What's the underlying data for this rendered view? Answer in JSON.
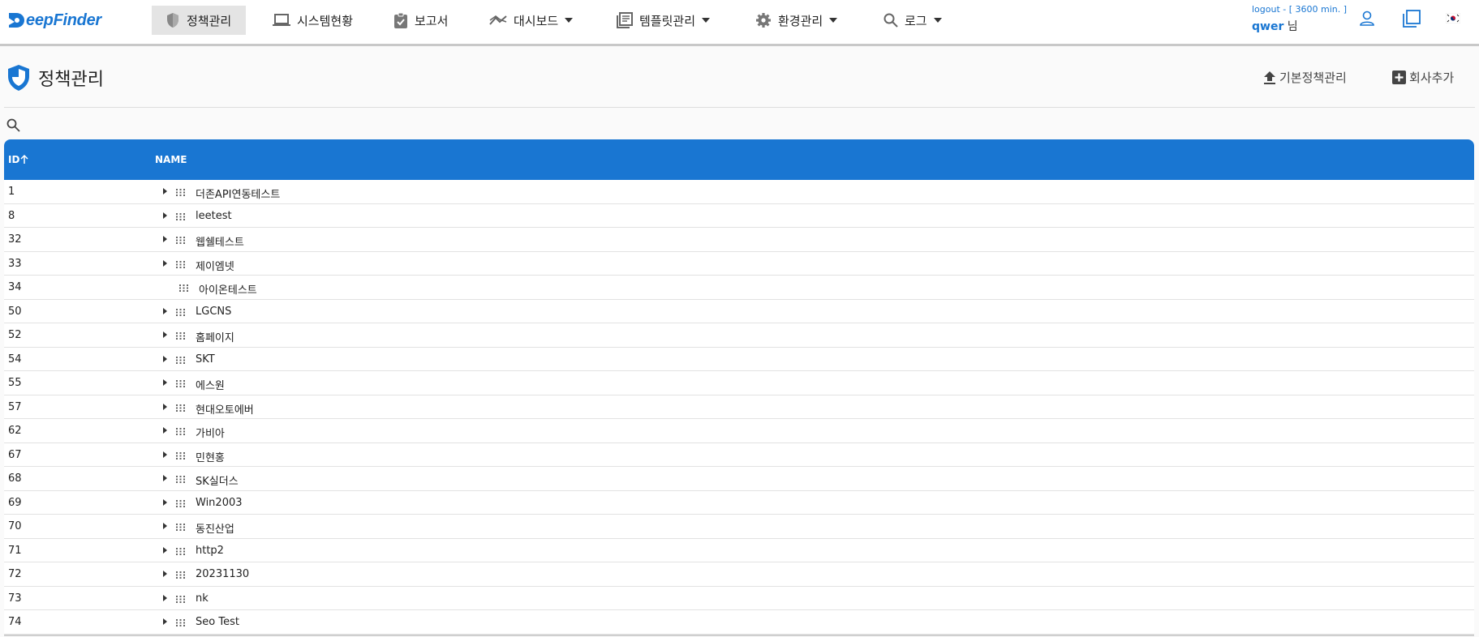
{
  "brand": "DeepFinder",
  "nav": [
    {
      "label": "정책관리",
      "icon": "shield-icon",
      "active": true
    },
    {
      "label": "시스템현황",
      "icon": "laptop-icon"
    },
    {
      "label": "보고서",
      "icon": "clipboard-check-icon"
    },
    {
      "label": "대시보드",
      "icon": "trend-icon",
      "dropdown": true
    },
    {
      "label": "템플릿관리",
      "icon": "template-book-icon",
      "dropdown": true
    },
    {
      "label": "환경관리",
      "icon": "gear-icon",
      "dropdown": true
    },
    {
      "label": "로그",
      "icon": "search-icon",
      "dropdown": true
    }
  ],
  "session": {
    "logout": "logout - [ 3600 min. ]",
    "username": "qwer",
    "suffix": " 님"
  },
  "header_icons": [
    "user-icon",
    "copy-window-icon",
    "korea-flag-icon"
  ],
  "page": {
    "title": "정책관리",
    "base_policy_btn": "기본정책관리",
    "add_company_btn": "회사추가"
  },
  "table": {
    "columns": [
      "ID",
      "NAME"
    ],
    "sort": {
      "column": "ID",
      "direction": "asc"
    },
    "rows": [
      {
        "id": "1",
        "name": "더존API연동테스트",
        "expandable": true
      },
      {
        "id": "8",
        "name": "leetest",
        "expandable": true
      },
      {
        "id": "32",
        "name": "웹쉘테스트",
        "expandable": true
      },
      {
        "id": "33",
        "name": "제이엠넷",
        "expandable": true
      },
      {
        "id": "34",
        "name": "아이온테스트",
        "expandable": false
      },
      {
        "id": "50",
        "name": "LGCNS",
        "expandable": true
      },
      {
        "id": "52",
        "name": "홈페이지",
        "expandable": true
      },
      {
        "id": "54",
        "name": "SKT",
        "expandable": true
      },
      {
        "id": "55",
        "name": "에스원",
        "expandable": true
      },
      {
        "id": "57",
        "name": "현대오토에버",
        "expandable": true
      },
      {
        "id": "62",
        "name": "가비아",
        "expandable": true
      },
      {
        "id": "67",
        "name": "민현홍",
        "expandable": true
      },
      {
        "id": "68",
        "name": "SK실더스",
        "expandable": true
      },
      {
        "id": "69",
        "name": "Win2003",
        "expandable": true
      },
      {
        "id": "70",
        "name": "동진산업",
        "expandable": true
      },
      {
        "id": "71",
        "name": "http2",
        "expandable": true
      },
      {
        "id": "72",
        "name": "20231130",
        "expandable": true
      },
      {
        "id": "73",
        "name": "nk",
        "expandable": true
      },
      {
        "id": "74",
        "name": "Seo Test",
        "expandable": true
      }
    ]
  },
  "colors": {
    "accent": "#1976d2",
    "nav_active_bg": "#e4e4e4"
  }
}
